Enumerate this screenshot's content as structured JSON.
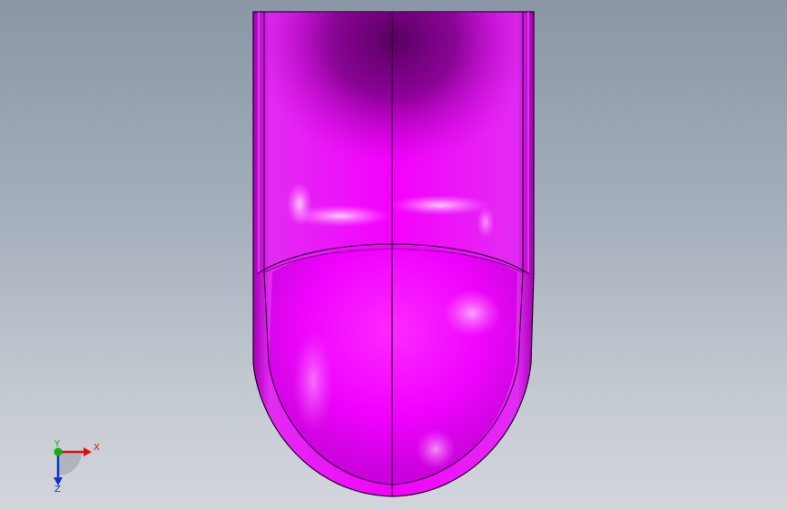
{
  "viewport": {
    "background_top": "#8a96a6",
    "background_bottom": "#d2d6db"
  },
  "model": {
    "body_color": "#e000f0",
    "shadow_color": "#5a005f",
    "highlight_color": "#ffb8ff"
  },
  "triad": {
    "x_label": "X",
    "y_label": "Y",
    "z_label": "Z",
    "x_color": "#e01010",
    "y_color": "#10b010",
    "z_color": "#1030d0"
  }
}
